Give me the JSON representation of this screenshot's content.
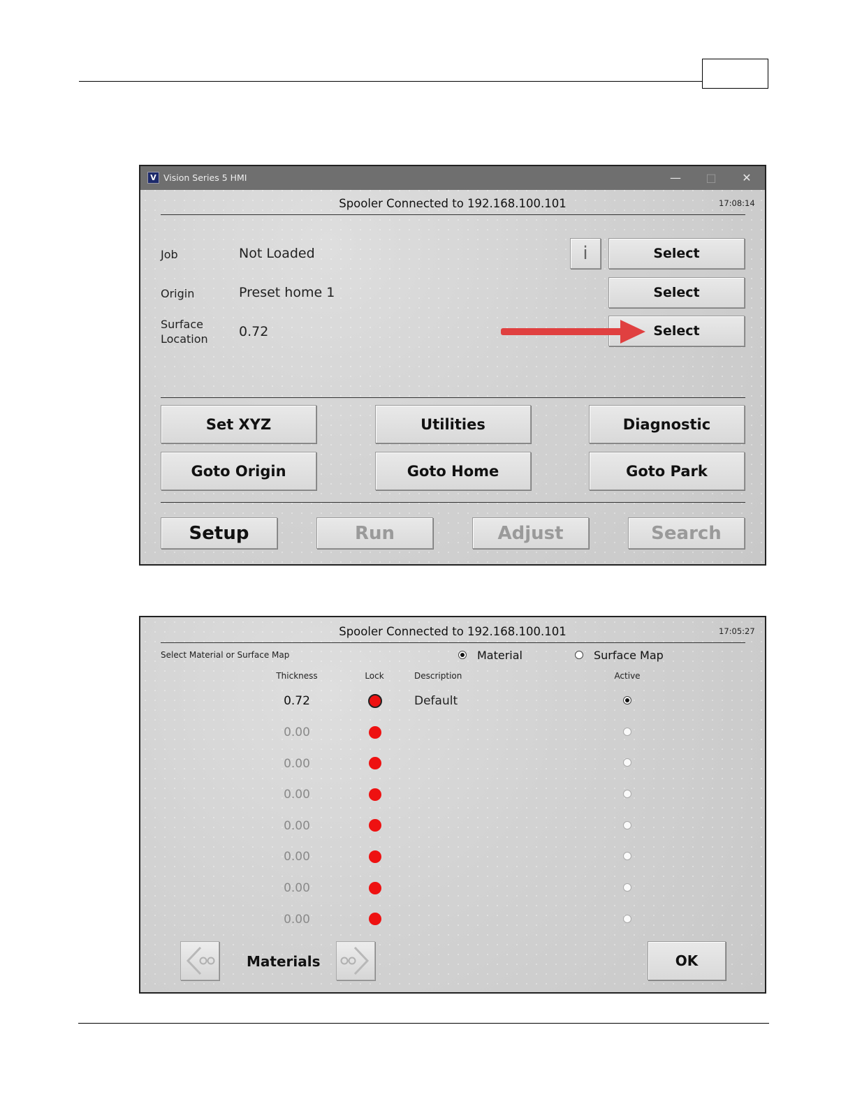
{
  "window1": {
    "title": "Vision Series 5 HMI",
    "logo_letter": "V",
    "controls": {
      "minimize": "—",
      "maximize": "□",
      "close": "✕"
    },
    "status": "Spooler Connected to 192.168.100.101",
    "clock": "17:08:14",
    "rows": [
      {
        "label": "Job",
        "value": "Not Loaded",
        "button": "Select"
      },
      {
        "label": "Origin",
        "value": "Preset home 1",
        "button": "Select"
      },
      {
        "label_line1": "Surface",
        "label_line2": "Location",
        "value": "0.72",
        "button": "Select"
      }
    ],
    "info_button": "i",
    "action_buttons": [
      "Set XYZ",
      "Utilities",
      "Diagnostic",
      "Goto Origin",
      "Goto Home",
      "Goto Park"
    ],
    "nav_buttons": [
      {
        "label": "Setup",
        "enabled": true
      },
      {
        "label": "Run",
        "enabled": false
      },
      {
        "label": "Adjust",
        "enabled": false
      },
      {
        "label": "Search",
        "enabled": false
      }
    ],
    "arrow_color": "#e04040"
  },
  "window2": {
    "status": "Spooler Connected to 192.168.100.101",
    "clock": "17:05:27",
    "prompt": "Select Material or Surface Map",
    "mode_options": [
      {
        "label": "Material",
        "selected": true
      },
      {
        "label": "Surface Map",
        "selected": false
      }
    ],
    "columns": {
      "thickness": "Thickness",
      "lock": "Lock",
      "description": "Description",
      "active": "Active"
    },
    "rows": [
      {
        "thickness": "0.72",
        "description": "Default",
        "active": true
      },
      {
        "thickness": "0.00",
        "description": "",
        "active": false
      },
      {
        "thickness": "0.00",
        "description": "",
        "active": false
      },
      {
        "thickness": "0.00",
        "description": "",
        "active": false
      },
      {
        "thickness": "0.00",
        "description": "",
        "active": false
      },
      {
        "thickness": "0.00",
        "description": "",
        "active": false
      },
      {
        "thickness": "0.00",
        "description": "",
        "active": false
      },
      {
        "thickness": "0.00",
        "description": "",
        "active": false
      }
    ],
    "page_label": "Materials",
    "ok_button": "OK",
    "lock_color": "#ee1111"
  }
}
